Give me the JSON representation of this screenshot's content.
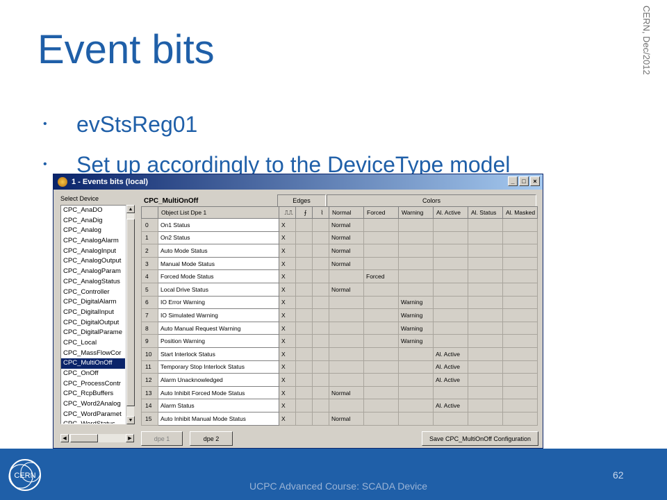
{
  "slide": {
    "title": "Event bits",
    "side_text": "CERN, Dec/2012",
    "bullets": [
      "evStsReg01",
      "Set up accordingly to the DeviceType model"
    ],
    "page_number": "62",
    "footer": "UCPC Advanced Course: SCADA Device"
  },
  "window": {
    "title": "1 - Events bits (local)",
    "buttons": {
      "minimize": "_",
      "maximize": "□",
      "close": "×"
    },
    "select_device_label": "Select Device",
    "devices": [
      "CPC_AnaDO",
      "CPC_AnaDig",
      "CPC_Analog",
      "CPC_AnalogAlarm",
      "CPC_AnalogInput",
      "CPC_AnalogOutput",
      "CPC_AnalogParam",
      "CPC_AnalogStatus",
      "CPC_Controller",
      "CPC_DigitalAlarm",
      "CPC_DigitalInput",
      "CPC_DigitalOutput",
      "CPC_DigitalParame",
      "CPC_Local",
      "CPC_MassFlowCor",
      "CPC_MultiOnOff",
      "CPC_OnOff",
      "CPC_ProcessContr",
      "CPC_RcpBuffers",
      "CPC_Word2Analog",
      "CPC_WordParamet",
      "CPC_WordStatus"
    ],
    "selected_device_index": 15,
    "device_type_label": "CPC_MultiOnOff",
    "group_edges": "Edges",
    "group_colors": "Colors",
    "columns": [
      "",
      "Object List Dpe 1",
      "⎍⎍",
      "⨍",
      "⌇",
      "Normal",
      "Forced",
      "Warning",
      "Al. Active",
      "Al. Status",
      "Al. Masked"
    ],
    "rows": [
      {
        "idx": "0",
        "name": "On1 Status",
        "edge": "X",
        "color": "Normal",
        "col": "normal"
      },
      {
        "idx": "1",
        "name": "On2 Status",
        "edge": "X",
        "color": "Normal",
        "col": "normal"
      },
      {
        "idx": "2",
        "name": "Auto Mode Status",
        "edge": "X",
        "color": "Normal",
        "col": "normal"
      },
      {
        "idx": "3",
        "name": "Manual Mode Status",
        "edge": "X",
        "color": "Normal",
        "col": "normal"
      },
      {
        "idx": "4",
        "name": "Forced Mode Status",
        "edge": "X",
        "color": "Forced",
        "col": "forced"
      },
      {
        "idx": "5",
        "name": "Local Drive Status",
        "edge": "X",
        "color": "Normal",
        "col": "normal"
      },
      {
        "idx": "6",
        "name": "IO Error Warning",
        "edge": "X",
        "color": "Warning",
        "col": "warning"
      },
      {
        "idx": "7",
        "name": "IO Simulated Warning",
        "edge": "X",
        "color": "Warning",
        "col": "warning"
      },
      {
        "idx": "8",
        "name": "Auto Manual Request Warning",
        "edge": "X",
        "color": "Warning",
        "col": "warning"
      },
      {
        "idx": "9",
        "name": "Position Warning",
        "edge": "X",
        "color": "Warning",
        "col": "warning"
      },
      {
        "idx": "10",
        "name": "Start Interlock Status",
        "edge": "X",
        "color": "Al. Active",
        "col": "active"
      },
      {
        "idx": "11",
        "name": "Temporary Stop Interlock Status",
        "edge": "X",
        "color": "Al. Active",
        "col": "active"
      },
      {
        "idx": "12",
        "name": "Alarm Unacknowledged",
        "edge": "X",
        "color": "Al. Active",
        "col": "active"
      },
      {
        "idx": "13",
        "name": "Auto Inhibit Forced Mode Status",
        "edge": "X",
        "color": "Normal",
        "col": "normal"
      },
      {
        "idx": "14",
        "name": "Alarm Status",
        "edge": "X",
        "color": "Al. Active",
        "col": "active"
      },
      {
        "idx": "15",
        "name": "Auto Inhibit Manual Mode Status",
        "edge": "X",
        "color": "Normal",
        "col": "normal"
      }
    ],
    "buttons_bottom": {
      "dpe1": "dpe 1",
      "dpe2": "dpe 2",
      "save": "Save CPC_MultiOnOff Configuration"
    }
  },
  "colors": {
    "accent": "#1f5fa8",
    "forced": "#e8e000",
    "warning": "#ff8c00",
    "active": "#ff0000",
    "selection": "#0a246a"
  },
  "logo_text": "CERN"
}
